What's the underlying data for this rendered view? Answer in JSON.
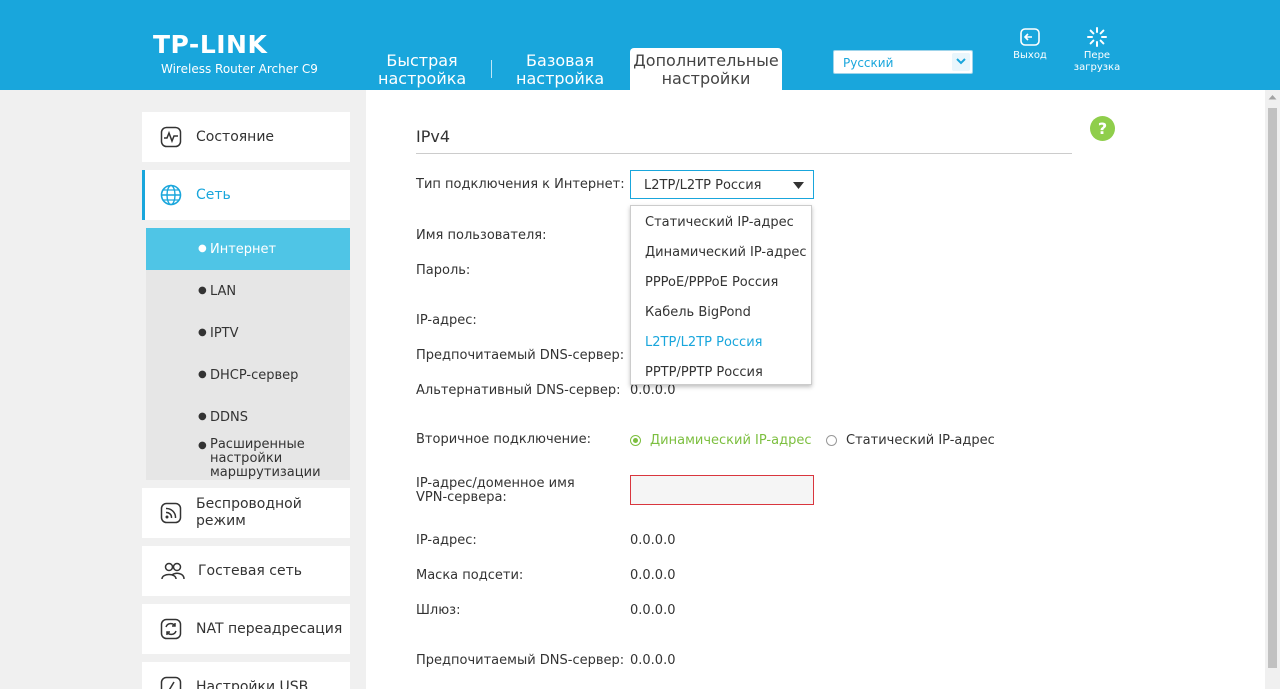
{
  "header": {
    "brand": "TP-LINK",
    "model": "Wireless Router Archer C9",
    "tabs": [
      {
        "line1": "Быстрая",
        "line2": "настройка"
      },
      {
        "line1": "Базовая",
        "line2": "настройка"
      },
      {
        "line1": "Дополнительные",
        "line2": "настройки"
      }
    ],
    "language": "Русский",
    "logout_label": "Выход",
    "reboot_line1": "Пере",
    "reboot_line2": "загрузка"
  },
  "sidebar": {
    "items": [
      {
        "label": "Состояние"
      },
      {
        "label": "Сеть"
      },
      {
        "label_line1": "Беспроводной",
        "label_line2": "режим"
      },
      {
        "label": "Гостевая сеть"
      },
      {
        "label": "NAT переадресация"
      },
      {
        "label": "Настройки USB"
      }
    ],
    "network_submenu": [
      {
        "label": "Интернет"
      },
      {
        "label": "LAN"
      },
      {
        "label": "IPTV"
      },
      {
        "label": "DHCP-сервер"
      },
      {
        "label": "DDNS"
      },
      {
        "line1": "Расширенные",
        "line2": "настройки",
        "line3": "маршрутизации"
      }
    ]
  },
  "main": {
    "section_title": "IPv4",
    "connection_type_label": "Тип подключения к Интернет:",
    "connection_type_value": "L2TP/L2TP Россия",
    "connection_options": [
      "Статический IP-адрес",
      "Динамический IP-адрес",
      "PPPoE/PPPoE Россия",
      "Кабель BigPond",
      "L2TP/L2TP Россия",
      "PPTP/PPTP Россия"
    ],
    "username_label": "Имя пользователя:",
    "password_label": "Пароль:",
    "ip_label": "IP-адрес:",
    "primary_dns_label": "Предпочитаемый DNS-сервер:",
    "alt_dns_label": "Альтернативный DNS-сервер:",
    "alt_dns_value": "0.0.0.0",
    "secondary_label": "Вторичное подключение:",
    "secondary_dynamic": "Динамический IP-адрес",
    "secondary_static": "Статический IP-адрес",
    "vpn_label_line1": "IP-адрес/доменное имя",
    "vpn_label_line2": "VPN-сервера:",
    "vpn_value": "",
    "ip2_label": "IP-адрес:",
    "ip2_value": "0.0.0.0",
    "mask_label": "Маска подсети:",
    "mask_value": "0.0.0.0",
    "gateway_label": "Шлюз:",
    "gateway_value": "0.0.0.0",
    "primary_dns2_label": "Предпочитаемый DNS-сервер:",
    "primary_dns2_value": "0.0.0.0",
    "help_glyph": "?"
  },
  "colors": {
    "brand_blue": "#19a6dc",
    "active_sub": "#4fc5e6",
    "green": "#7cbf3f",
    "error_red": "#d9363e"
  }
}
